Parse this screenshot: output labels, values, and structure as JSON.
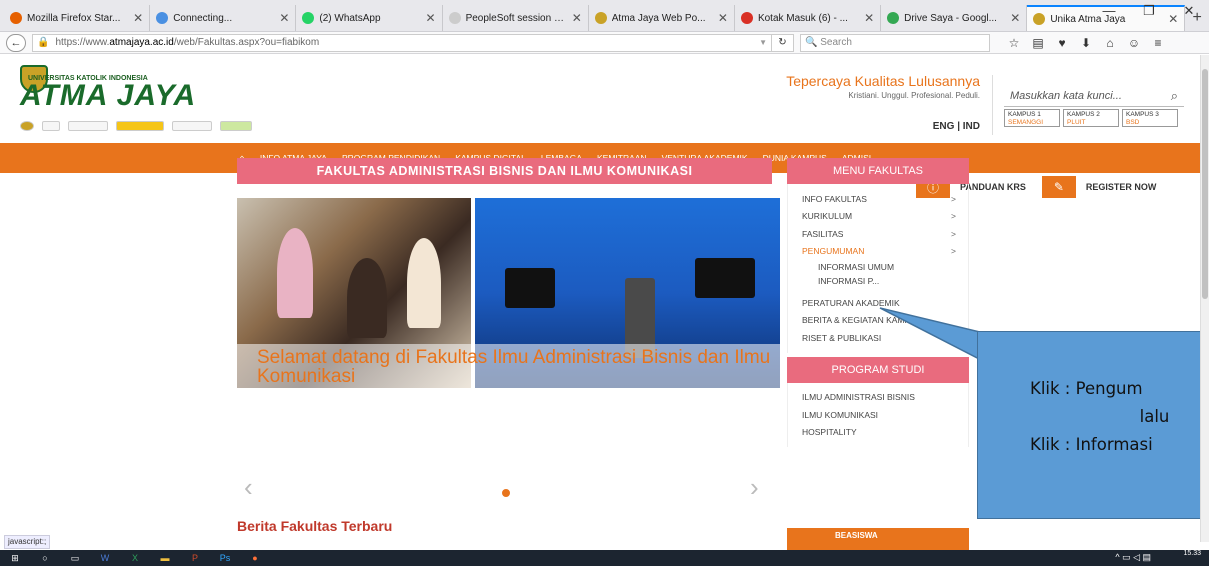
{
  "browser": {
    "tabs": [
      {
        "label": "Mozilla Firefox Star...",
        "color": "#e66000"
      },
      {
        "label": "Connecting...",
        "color": "#4a90e2"
      },
      {
        "label": "(2) WhatsApp",
        "color": "#25d366"
      },
      {
        "label": "PeopleSoft session expi...",
        "color": "#cccccc"
      },
      {
        "label": "Atma Jaya Web Po...",
        "color": "#c9a227"
      },
      {
        "label": "Kotak Masuk (6) - ...",
        "color": "#d93025"
      },
      {
        "label": "Drive Saya - Googl...",
        "color": "#34a853"
      },
      {
        "label": "Unika Atma Jaya",
        "color": "#c9a227"
      }
    ],
    "url_prefix": "https://www.",
    "url_domain": "atmajaya.ac.id",
    "url_path": "/web/Fakultas.aspx?ou=fiabikom",
    "search_placeholder": "Search",
    "status_text": "javascript:;"
  },
  "header": {
    "uni_small": "UNIVERSITAS KATOLIK INDONESIA",
    "uni_name": "ATMA JAYA",
    "tagline_1": "Tepercaya Kualitas Lulusannya",
    "tagline_2": "Kristiani. Unggul. Profesional. Peduli.",
    "lang": "ENG | IND",
    "search_placeholder": "Masukkan kata kunci...",
    "campuses": [
      {
        "name": "KAMPUS 1",
        "loc": "SEMANGGI"
      },
      {
        "name": "KAMPUS 2",
        "loc": "PLUIT"
      },
      {
        "name": "KAMPUS 3",
        "loc": "BSD"
      }
    ]
  },
  "menu": [
    "INFO ATMA JAYA",
    "PROGRAM PENDIDIKAN",
    "KAMPUS DIGITAL",
    "LEMBAGA",
    "KEMITRAAN",
    "VENTURA AKADEMIK",
    "DUNIA KAMPUS",
    "ADMISI"
  ],
  "quick_links": {
    "panduan": "PANDUAN KRS",
    "register": "REGISTER NOW"
  },
  "main": {
    "title": "FAKULTAS ADMINISTRASI BISNIS DAN ILMU KOMUNIKASI",
    "caption": "Selamat datang di Fakultas Ilmu Administrasi Bisnis dan Ilmu Komunikasi",
    "news_heading": "Berita Fakultas Terbaru"
  },
  "sidebar": {
    "menu_title": "MENU FAKULTAS",
    "items": [
      {
        "label": "INFO FAKULTAS",
        "arrow": ">"
      },
      {
        "label": "KURIKULUM",
        "arrow": ">"
      },
      {
        "label": "FASILITAS",
        "arrow": ">"
      },
      {
        "label": "PENGUMUMAN",
        "arrow": ">"
      }
    ],
    "subitems": [
      "INFORMASI UMUM",
      "INFORMASI P..."
    ],
    "items2": [
      "PERATURAN AKADEMIK",
      "BERITA & KEGIATAN KAMPUS",
      "RISET & PUBLIKASI"
    ],
    "program_title": "PROGRAM STUDI",
    "programs": [
      "ILMU ADMINISTRASI BISNIS",
      "ILMU KOMUNIKASI",
      "HOSPITALITY"
    ],
    "beasiswa": "BEASISWA"
  },
  "callout": {
    "line1": "Klik : Pengum",
    "line2": "lalu",
    "line3": "Klik : Informasi"
  },
  "taskbar": {
    "time": "15.33"
  }
}
